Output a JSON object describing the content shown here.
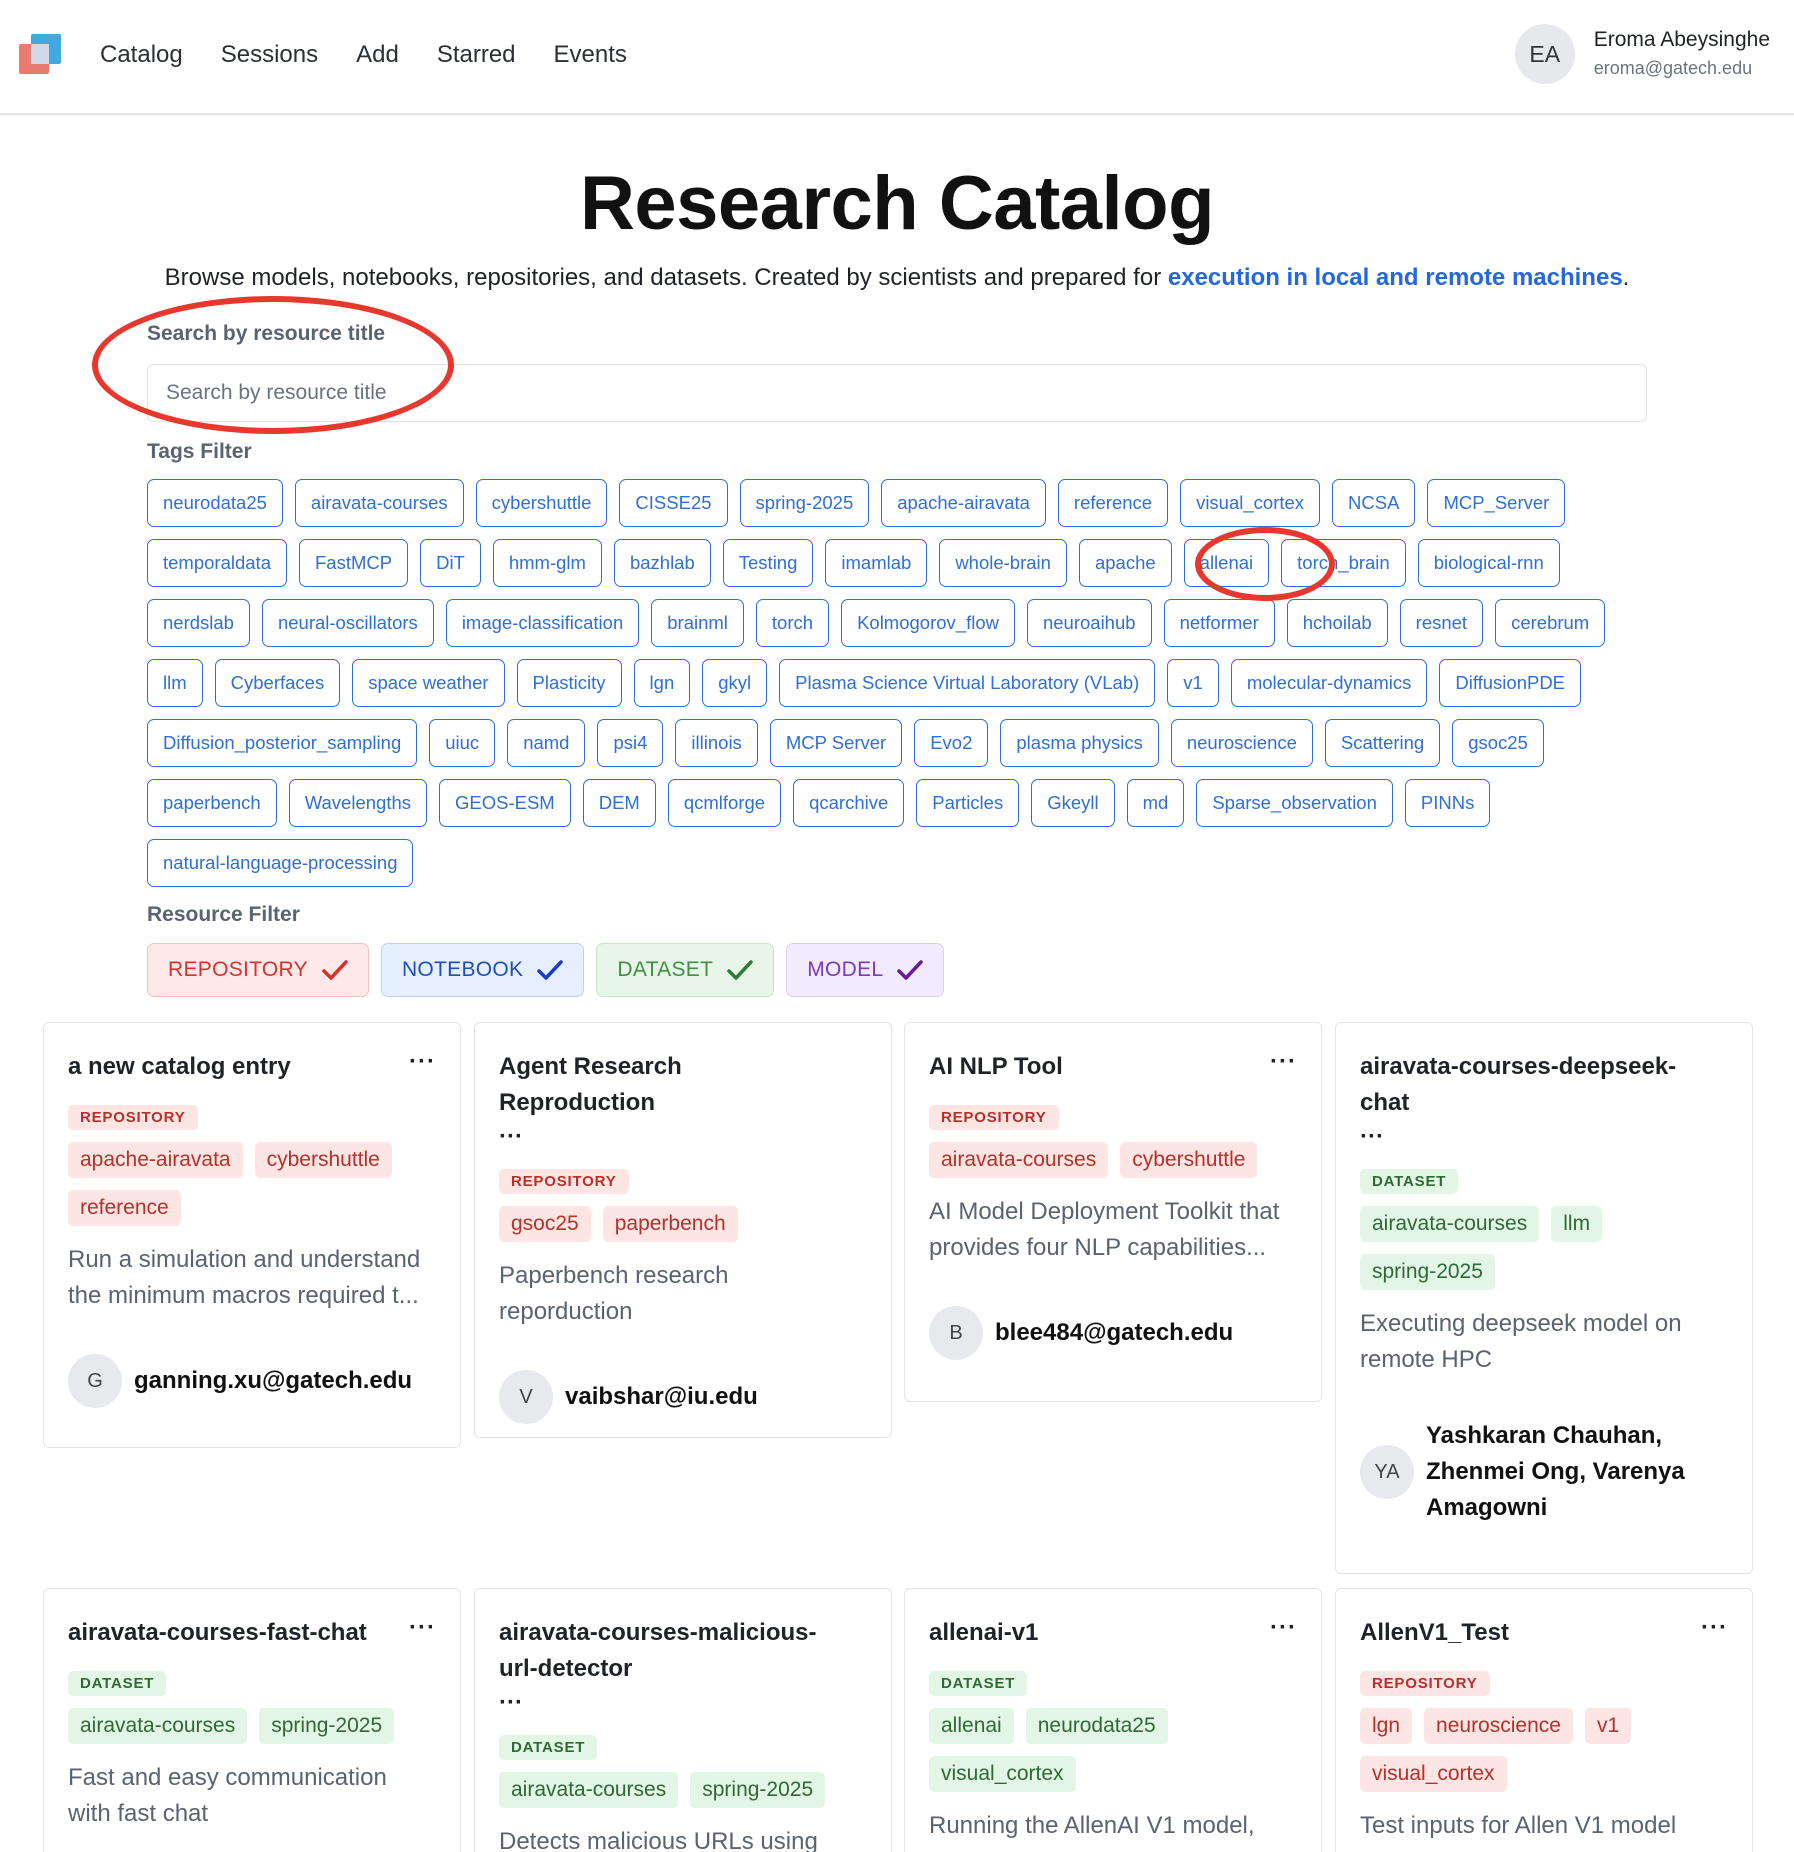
{
  "nav": {
    "items": [
      "Catalog",
      "Sessions",
      "Add",
      "Starred",
      "Events"
    ],
    "user": {
      "initials": "EA",
      "name": "Eroma Abeysinghe",
      "email": "eroma@gatech.edu"
    }
  },
  "header": {
    "title": "Research Catalog",
    "subtitle_prefix": "Browse models, notebooks, repositories, and datasets. Created by scientists and prepared for ",
    "subtitle_link": "execution in local and remote machines",
    "subtitle_suffix": "."
  },
  "search": {
    "label": "Search by resource title",
    "placeholder": "Search by resource title",
    "value": ""
  },
  "tags_filter": {
    "label": "Tags Filter",
    "tags": [
      "neurodata25",
      "airavata-courses",
      "cybershuttle",
      "CISSE25",
      "spring-2025",
      "apache-airavata",
      "reference",
      "visual_cortex",
      "NCSA",
      "MCP_Server",
      "temporaldata",
      "FastMCP",
      "DiT",
      "hmm-glm",
      "bazhlab",
      "Testing",
      "imamlab",
      "whole-brain",
      "apache",
      "allenai",
      "torch_brain",
      "biological-rnn",
      "nerdslab",
      "neural-oscillators",
      "image-classification",
      "brainml",
      "torch",
      "Kolmogorov_flow",
      "neuroaihub",
      "netformer",
      "hchoilab",
      "resnet",
      "cerebrum",
      "llm",
      "Cyberfaces",
      "space weather",
      "Plasticity",
      "lgn",
      "gkyl",
      "Plasma Science Virtual Laboratory (VLab)",
      "v1",
      "molecular-dynamics",
      "DiffusionPDE",
      "Diffusion_posterior_sampling",
      "uiuc",
      "namd",
      "psi4",
      "illinois",
      "MCP Server",
      "Evo2",
      "plasma physics",
      "neuroscience",
      "Scattering",
      "gsoc25",
      "paperbench",
      "Wavelengths",
      "GEOS-ESM",
      "DEM",
      "qcmlforge",
      "qcarchive",
      "Particles",
      "Gkeyll",
      "md",
      "Sparse_observation",
      "PINNs",
      "natural-language-processing"
    ]
  },
  "resource_filter": {
    "label": "Resource Filter",
    "options": [
      {
        "label": "REPOSITORY",
        "checked": true,
        "color": "#d3322f"
      },
      {
        "label": "NOTEBOOK",
        "checked": true,
        "color": "#1f4fb8"
      },
      {
        "label": "DATASET",
        "checked": true,
        "color": "#3f8f47"
      },
      {
        "label": "MODEL",
        "checked": true,
        "color": "#7b3ab8"
      }
    ]
  },
  "cards": [
    {
      "title": "a new catalog entry",
      "more": "···",
      "ellipsis": "",
      "type": "REPOSITORY",
      "tags": [
        "apache-airavata",
        "cybershuttle",
        "reference"
      ],
      "description": "Run a simulation and understand the minimum macros required t...",
      "author_initials": "G",
      "author": "ganning.xu@gatech.edu"
    },
    {
      "title": "Agent Research Reproduction",
      "more": "",
      "ellipsis": "···",
      "type": "REPOSITORY",
      "tags": [
        "gsoc25",
        "paperbench"
      ],
      "description": "Paperbench research reporduction",
      "author_initials": "V",
      "author": "vaibshar@iu.edu"
    },
    {
      "title": "AI NLP Tool",
      "more": "···",
      "ellipsis": "",
      "type": "REPOSITORY",
      "tags": [
        "airavata-courses",
        "cybershuttle"
      ],
      "description": "AI Model Deployment Toolkit that provides four NLP capabilities...",
      "author_initials": "B",
      "author": "blee484@gatech.edu"
    },
    {
      "title": "airavata-courses-deepseek-chat",
      "more": "",
      "ellipsis": "···",
      "type": "DATASET",
      "tags": [
        "airavata-courses",
        "llm",
        "spring-2025"
      ],
      "description": "Executing deepseek model on remote HPC",
      "author_initials": "YA",
      "author": "Yashkaran Chauhan, Zhenmei Ong, Varenya Amagowni"
    },
    {
      "title": "airavata-courses-fast-chat",
      "more": "···",
      "ellipsis": "",
      "type": "DATASET",
      "tags": [
        "airavata-courses",
        "spring-2025"
      ],
      "description": "Fast and easy communication with fast chat",
      "author_initials": "",
      "author": ""
    },
    {
      "title": "airavata-courses-malicious-url-detector",
      "more": "",
      "ellipsis": "···",
      "type": "DATASET",
      "tags": [
        "airavata-courses",
        "spring-2025"
      ],
      "description": "Detects malicious URLs using",
      "author_initials": "",
      "author": ""
    },
    {
      "title": "allenai-v1",
      "more": "···",
      "ellipsis": "",
      "type": "DATASET",
      "tags": [
        "allenai",
        "neurodata25",
        "visual_cortex"
      ],
      "description": "Running the AllenAI V1 model,",
      "author_initials": "",
      "author": ""
    },
    {
      "title": "AllenV1_Test",
      "more": "···",
      "ellipsis": "",
      "type": "REPOSITORY",
      "tags": [
        "lgn",
        "neuroscience",
        "v1",
        "visual_cortex"
      ],
      "description": "Test inputs for Allen V1 model",
      "author_initials": "",
      "author": ""
    }
  ]
}
